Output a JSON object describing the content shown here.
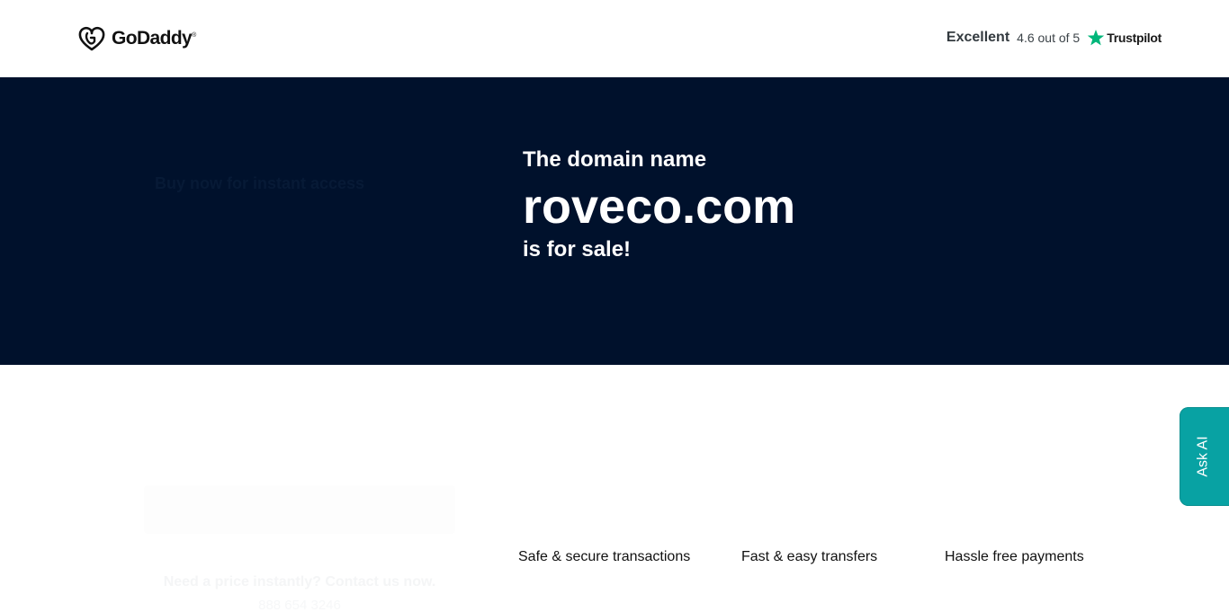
{
  "header": {
    "logo_text": "GoDaddy",
    "logo_tm": "®",
    "trustpilot": {
      "rating_label": "Excellent",
      "score_text": "4.6 out of 5",
      "brand": "Trustpilot",
      "star_color": "#00b67a"
    }
  },
  "hero": {
    "line1": "The domain name",
    "domain": "roveco.com",
    "line3": "is for sale!",
    "background": "#00112c",
    "ghost_text": "Buy now for instant access"
  },
  "lower": {
    "contact_text": "Need a price instantly? Contact us now.",
    "phone": "888 654 3246",
    "features": [
      {
        "label": "Safe & secure transactions"
      },
      {
        "label": "Fast & easy transfers"
      },
      {
        "label": "Hassle free payments"
      }
    ]
  },
  "ask_ai": {
    "label": "Ask AI",
    "color": "#08a2a3"
  }
}
